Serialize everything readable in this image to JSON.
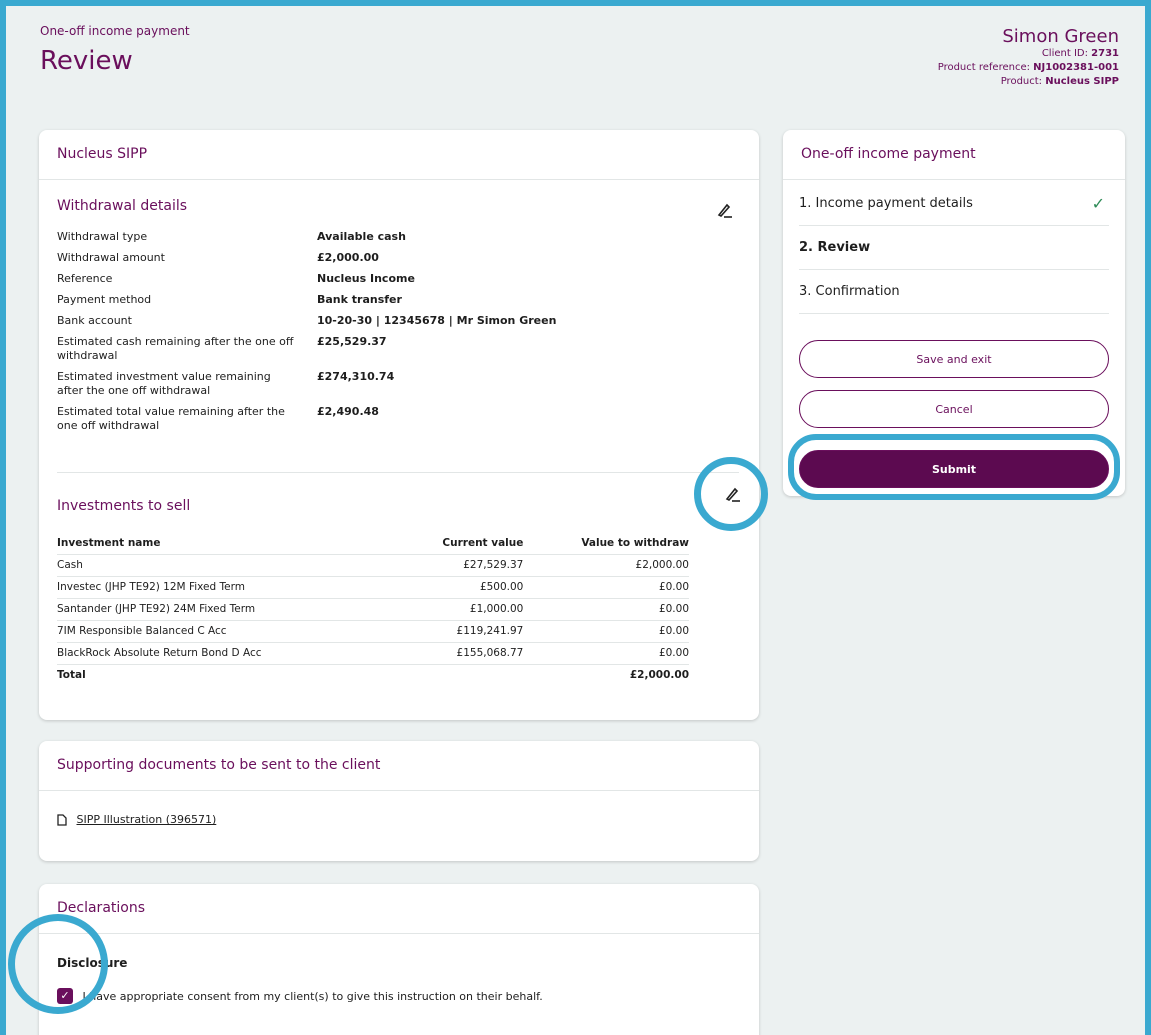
{
  "header": {
    "subtitle": "One-off income payment",
    "title": "Review",
    "client_name": "Simon Green",
    "client_id_label": "Client ID: ",
    "client_id": "2731",
    "product_ref_label": "Product reference: ",
    "product_ref": "NJ1002381-001",
    "product_label": "Product: ",
    "product": "Nucleus SIPP"
  },
  "main_card": {
    "title": "Nucleus SIPP",
    "withdrawal": {
      "title": "Withdrawal details",
      "rows": [
        {
          "key": "Withdrawal type",
          "value": "Available cash"
        },
        {
          "key": "Withdrawal amount",
          "value": "£2,000.00"
        },
        {
          "key": "Reference",
          "value": "Nucleus Income"
        },
        {
          "key": "Payment method",
          "value": "Bank transfer"
        },
        {
          "key": "Bank account",
          "value": "10-20-30 | 12345678 | Mr Simon Green"
        },
        {
          "key": "Estimated cash remaining after the one off withdrawal",
          "value": "£25,529.37"
        },
        {
          "key": "Estimated investment value remaining after the one off withdrawal",
          "value": "£274,310.74"
        },
        {
          "key": "Estimated total value remaining after the one off withdrawal",
          "value": "£2,490.48"
        }
      ]
    },
    "investments": {
      "title": "Investments to sell",
      "headers": [
        "Investment name",
        "Current value",
        "Value to withdraw"
      ],
      "rows": [
        [
          "Cash",
          "£27,529.37",
          "£2,000.00"
        ],
        [
          "Investec (JHP TE92) 12M Fixed Term",
          "£500.00",
          "£0.00"
        ],
        [
          "Santander (JHP TE92) 24M Fixed Term",
          "£1,000.00",
          "£0.00"
        ],
        [
          "7IM Responsible Balanced C Acc",
          "£119,241.97",
          "£0.00"
        ],
        [
          "BlackRock Absolute Return Bond D Acc",
          "£155,068.77",
          "£0.00"
        ]
      ],
      "total_label": "Total",
      "total_value": "£2,000.00"
    }
  },
  "documents_card": {
    "title": "Supporting documents to be sent to the client",
    "link": "SIPP Illustration (396571)"
  },
  "declarations_card": {
    "title": "Declarations",
    "subtitle": "Disclosure",
    "consent_text": "I have appropriate consent from my client(s) to give this instruction on their behalf."
  },
  "side_card": {
    "title": "One-off income payment",
    "steps": [
      "1.  Income payment details",
      "2.  Review",
      "3.  Confirmation"
    ],
    "save_label": "Save and exit",
    "cancel_label": "Cancel",
    "submit_label": "Submit"
  },
  "colors": {
    "brand": "#6a0f5c",
    "highlight": "#3aa9d0",
    "success": "#2e8b57"
  }
}
